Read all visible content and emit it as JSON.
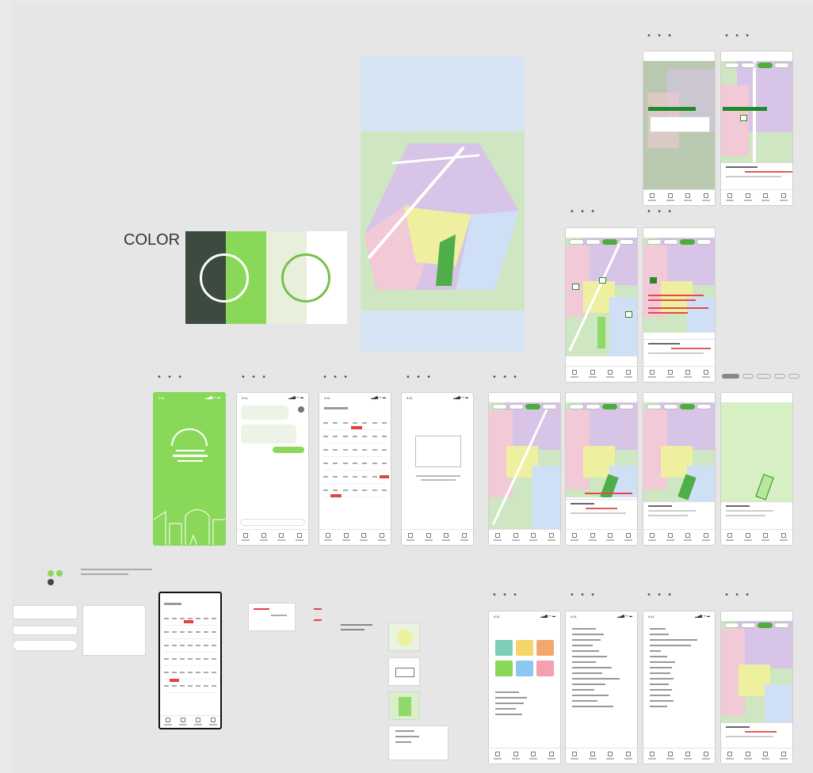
{
  "canvas": {
    "background": "#e6e6e6"
  },
  "color_section": {
    "label": "COLOR",
    "swatches": [
      "#3c4a40",
      "#8ad859",
      "#e8f0dc",
      "#ffffff"
    ]
  },
  "frame_marker": "• • •",
  "phone_status": {
    "time": "9:41",
    "icons": "▂▄▆ ᯤ ▬"
  },
  "palette": {
    "pink": "#f2c9d6",
    "lavender": "#d8c4e6",
    "yellow": "#eef0a0",
    "blue": "#cfdff5",
    "park_green": "#8fd86a",
    "accent_green": "#4caf3a",
    "alert_red": "#e24444"
  }
}
